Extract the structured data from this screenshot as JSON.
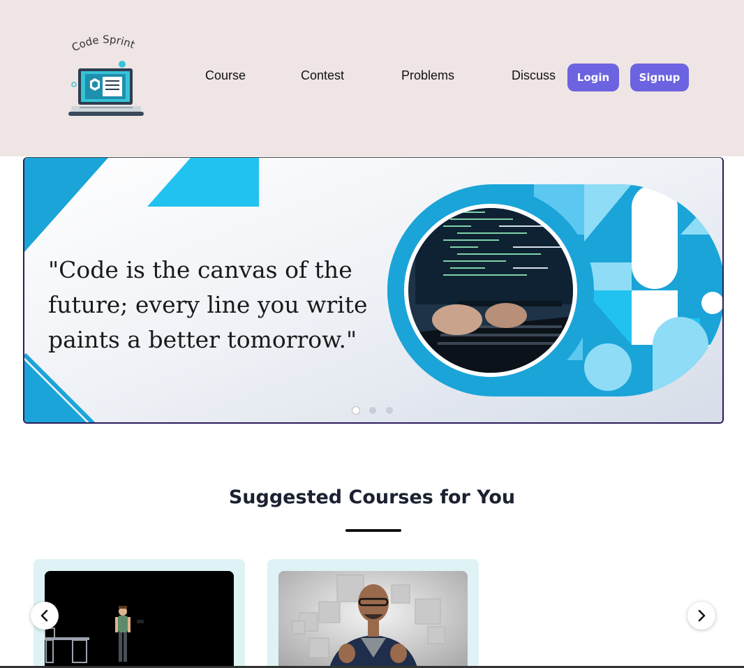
{
  "logo": {
    "text": "Code Sprint",
    "icon": "laptop-logo-icon"
  },
  "nav": {
    "course": "Course",
    "contest": "Contest",
    "problems": "Problems",
    "discuss": "Discuss"
  },
  "auth": {
    "login": "Login",
    "signup": "Signup"
  },
  "hero": {
    "quote_lines": [
      "\"Code is the canvas of the",
      "future; every line you write",
      "paints a better tomorrow.\""
    ],
    "slide_count": 3,
    "active_slide": 1
  },
  "courses": {
    "title": "Suggested Courses for You",
    "prev_icon": "chevron-left-icon",
    "next_icon": "chevron-right-icon"
  },
  "colors": {
    "header_bg": "#efe5e5",
    "accent": "#6c63e0",
    "hero_blue": "#1ba4d8",
    "card_bg": "#dff2f5"
  }
}
